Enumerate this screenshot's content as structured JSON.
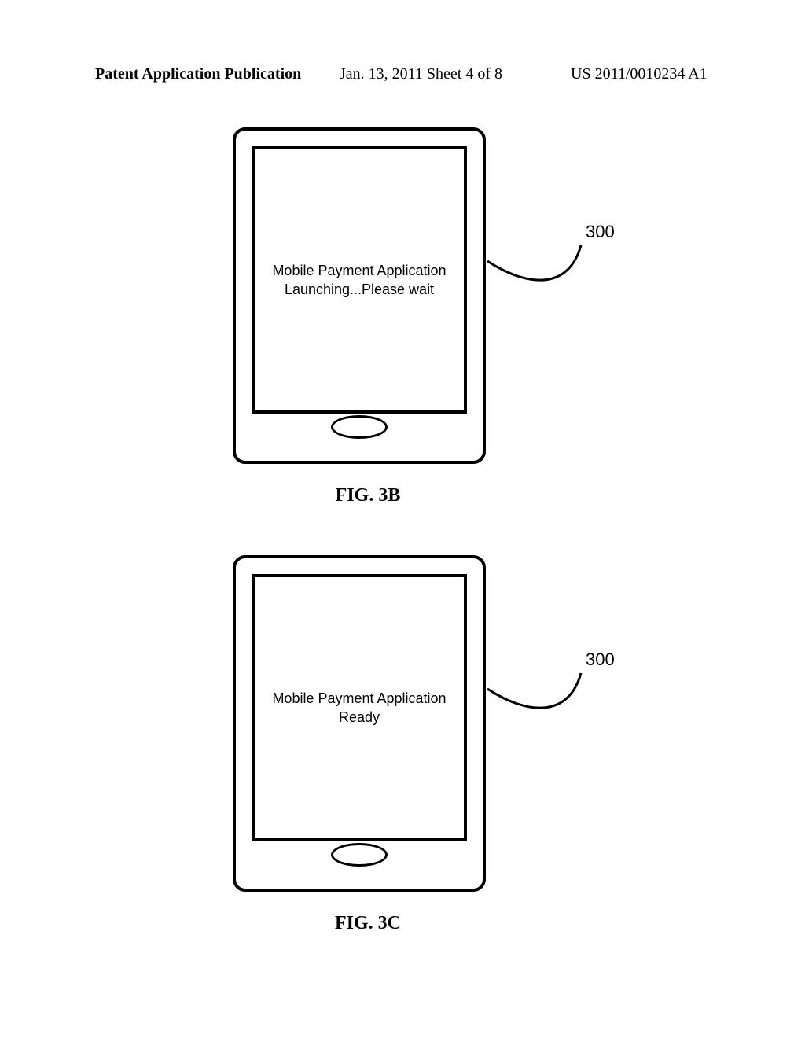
{
  "header": {
    "left": "Patent Application Publication",
    "middle": "Jan. 13, 2011  Sheet 4 of 8",
    "right": "US 2011/0010234 A1"
  },
  "figures": {
    "b": {
      "screen_line1": "Mobile Payment Application",
      "screen_line2": "Launching...Please wait",
      "ref": "300",
      "caption": "FIG. 3B"
    },
    "c": {
      "screen_line1": "Mobile Payment Application",
      "screen_line2": "Ready",
      "ref": "300",
      "caption": "FIG. 3C"
    }
  }
}
